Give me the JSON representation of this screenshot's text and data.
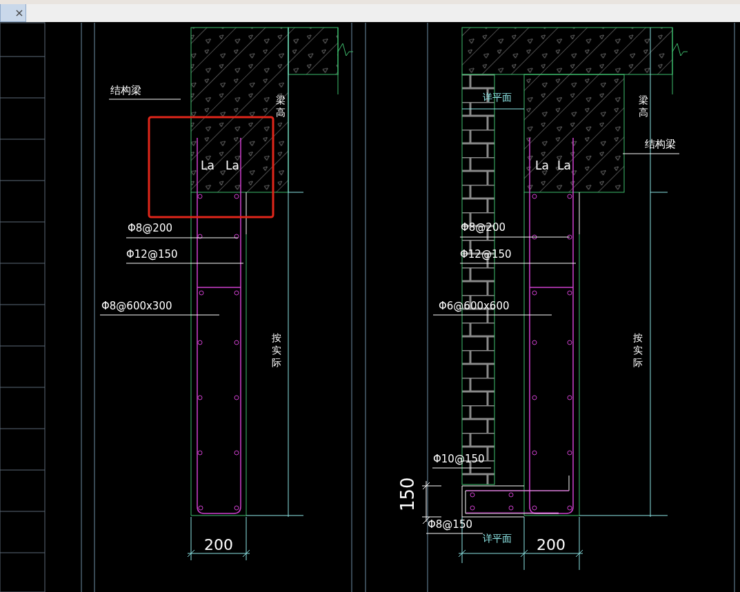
{
  "tab": {
    "close_glyph": "×"
  },
  "details": [
    {
      "annotations": [
        {
          "text": "结构梁",
          "kind": "leader"
        },
        {
          "text": "梁高",
          "kind": "vertical"
        },
        {
          "text": "La",
          "kind": "label"
        },
        {
          "text": "La",
          "kind": "label"
        },
        {
          "text": "Φ8@200",
          "kind": "leader"
        },
        {
          "text": "Φ12@150",
          "kind": "leader"
        },
        {
          "text": "Φ8@600x300",
          "kind": "leader"
        },
        {
          "text": "按实际",
          "kind": "vertical"
        },
        {
          "text": "200",
          "kind": "dimension"
        }
      ]
    },
    {
      "annotations": [
        {
          "text": "详平面",
          "kind": "reference"
        },
        {
          "text": "梁高",
          "kind": "vertical"
        },
        {
          "text": "结构梁",
          "kind": "leader"
        },
        {
          "text": "La",
          "kind": "label"
        },
        {
          "text": "La",
          "kind": "label"
        },
        {
          "text": "Φ8@200",
          "kind": "leader"
        },
        {
          "text": "Φ12@150",
          "kind": "leader"
        },
        {
          "text": "Φ6@600x600",
          "kind": "leader"
        },
        {
          "text": "按实际",
          "kind": "vertical"
        },
        {
          "text": "Φ10@150",
          "kind": "leader"
        },
        {
          "text": "150",
          "kind": "rotated"
        },
        {
          "text": "Φ8@150",
          "kind": "leader"
        },
        {
          "text": "详平面",
          "kind": "reference"
        },
        {
          "text": "200",
          "kind": "dimension"
        }
      ]
    }
  ]
}
